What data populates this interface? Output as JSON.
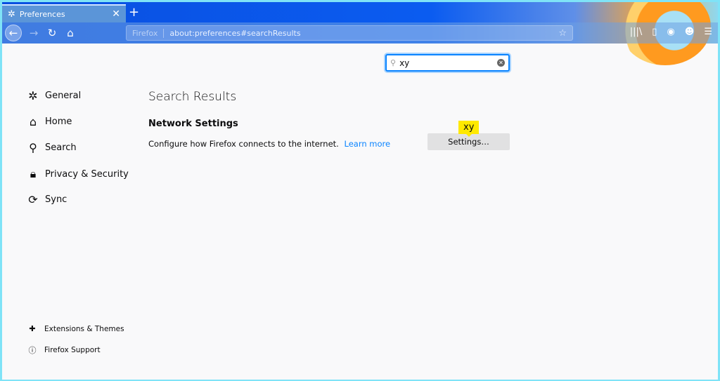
{
  "browser": {
    "tab_title": "Preferences",
    "tab_icon": "gear-icon",
    "url_identity": "Firefox",
    "url": "about:preferences#searchResults",
    "toolbar_icons": [
      "library-icon",
      "sidebar-icon",
      "account-icon",
      "private-mask-icon",
      "menu-icon"
    ]
  },
  "search": {
    "value": "xy"
  },
  "sidebar": {
    "items": [
      {
        "label": "General",
        "icon": "gear-icon"
      },
      {
        "label": "Home",
        "icon": "home-icon"
      },
      {
        "label": "Search",
        "icon": "search-icon"
      },
      {
        "label": "Privacy & Security",
        "icon": "lock-icon"
      },
      {
        "label": "Sync",
        "icon": "sync-icon"
      }
    ],
    "footer": [
      {
        "label": "Extensions & Themes",
        "icon": "puzzle-icon"
      },
      {
        "label": "Firefox Support",
        "icon": "help-icon"
      }
    ]
  },
  "main": {
    "title": "Search Results",
    "section": "Network Settings",
    "description": "Configure how Firefox connects to the internet.",
    "learn_more": "Learn more",
    "settings_button": "Settings…",
    "highlight_tooltip": "xy"
  },
  "colors": {
    "accent": "#0a84ff",
    "highlight": "#ffe900",
    "window_border": "#7fe3f7"
  }
}
